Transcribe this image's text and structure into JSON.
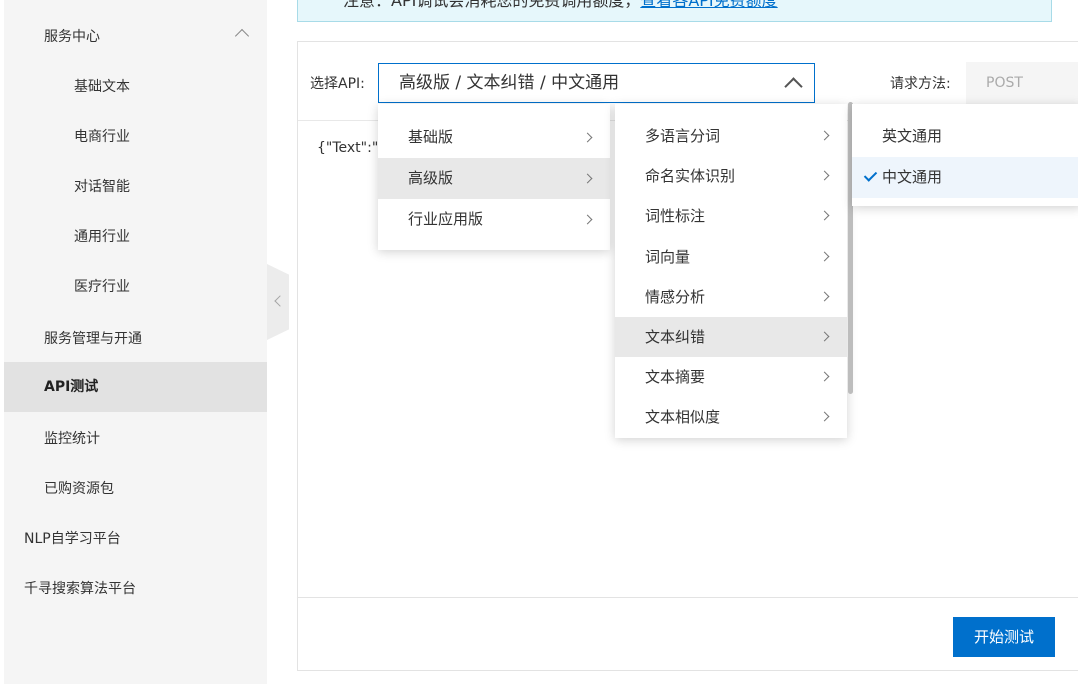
{
  "sidebar": {
    "items": [
      {
        "label": "服务中心",
        "level": 2,
        "expanded": true
      },
      {
        "label": "基础文本",
        "level": 3
      },
      {
        "label": "电商行业",
        "level": 3
      },
      {
        "label": "对话智能",
        "level": 3
      },
      {
        "label": "通用行业",
        "level": 3
      },
      {
        "label": "医疗行业",
        "level": 3
      },
      {
        "label": "服务管理与开通",
        "level": 2
      },
      {
        "label": "API测试",
        "level": 2,
        "active": true
      },
      {
        "label": "监控统计",
        "level": 2
      },
      {
        "label": "已购资源包",
        "level": 2
      },
      {
        "label": "NLP自学习平台",
        "level": 1
      },
      {
        "label": "千寻搜索算法平台",
        "level": 1
      }
    ]
  },
  "notice": {
    "text": "注意：API调试会消耗您的免费调用额度，",
    "link": "查看各API免费额度"
  },
  "form": {
    "api_label": "选择API:",
    "api_value": "高级版 / 文本纠错 / 中文通用",
    "method_label": "请求方法:",
    "method_value": "POST",
    "request_body": "{\"Text\":\"我"
  },
  "cascader": {
    "level1": [
      "基础版",
      "高级版",
      "行业应用版"
    ],
    "level1_selected": 1,
    "level2": [
      "多语言分词",
      "命名实体识别",
      "词性标注",
      "词向量",
      "情感分析",
      "文本纠错",
      "文本摘要",
      "文本相似度"
    ],
    "level2_selected": 5,
    "level3": [
      "英文通用",
      "中文通用"
    ],
    "level3_selected": 1
  },
  "actions": {
    "start_test": "开始测试"
  },
  "colors": {
    "accent": "#0070cc",
    "sidebar_bg": "#f5f5f5",
    "notice_bg": "#e6f7fb"
  }
}
